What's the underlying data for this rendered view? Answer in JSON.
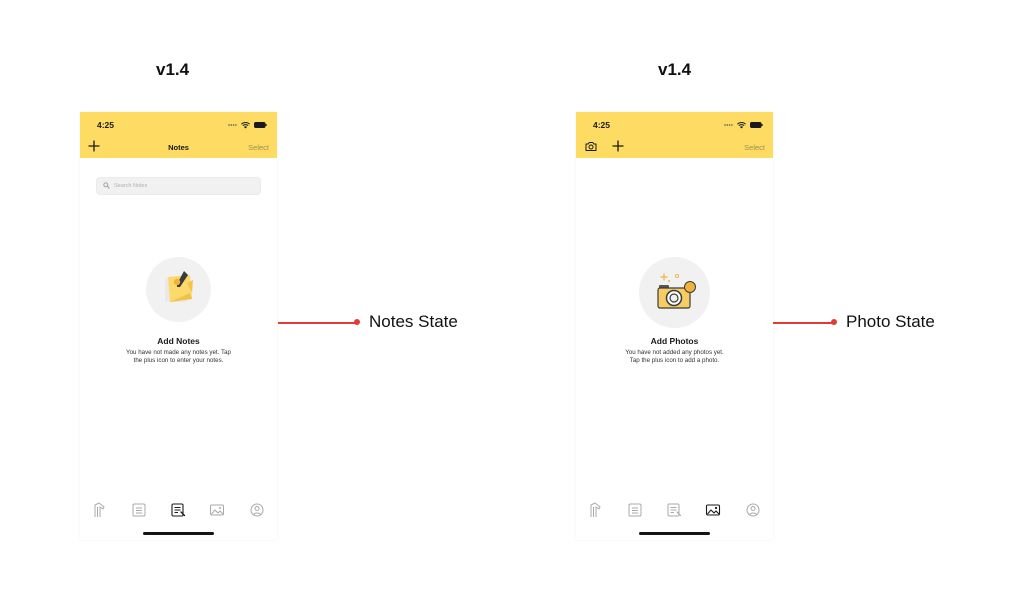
{
  "left": {
    "version": "v1.4",
    "status_time": "4:25",
    "header_title": "Notes",
    "select_label": "Select",
    "search_placeholder": "Search Notes",
    "empty_title": "Add Notes",
    "empty_desc": "You have not made any notes yet. Tap the plus icon to enter your notes.",
    "state_label": "Notes State",
    "active_tab": "notes"
  },
  "right": {
    "version": "v1.4",
    "status_time": "4:25",
    "select_label": "Select",
    "empty_title": "Add Photos",
    "empty_desc": "You have not added any photos yet. Tap the plus icon to add a photo.",
    "state_label": "Photo State",
    "active_tab": "photos"
  },
  "colors": {
    "header_bg": "#fedb62",
    "accent_red": "#e53935",
    "illustration_bg": "#f1f1f1",
    "note_yellow": "#f9c74f"
  },
  "tabs": [
    "home-icon",
    "list-icon",
    "notes-icon",
    "photos-icon",
    "profile-icon"
  ]
}
